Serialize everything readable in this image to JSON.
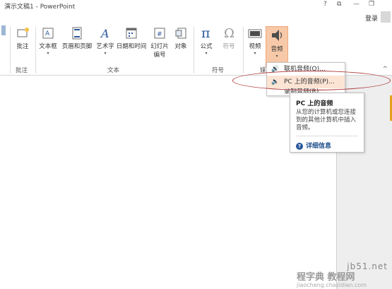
{
  "window": {
    "title": "演示文稿1 - PowerPoint",
    "help": "?",
    "restore_ribbon": "⧉",
    "minimize": "—",
    "maximize": "❐",
    "sign_in": "登录"
  },
  "ribbon": {
    "buttons": {
      "comment": "批注",
      "textbox": "文本框",
      "header_footer": "页眉和页脚",
      "wordart": "艺术字",
      "datetime": "日期和时间",
      "slide_number_l1": "幻灯片",
      "slide_number_l2": "编号",
      "object": "对象",
      "equation": "公式",
      "symbol": "符号",
      "video": "视频",
      "audio": "音频"
    },
    "groups": {
      "comments": "批注",
      "text": "文本",
      "symbols": "符号",
      "media": "媒"
    },
    "collapse": "^"
  },
  "audio_menu": {
    "items": [
      {
        "label": "联机音频(O)..."
      },
      {
        "label": "PC 上的音频(P)..."
      },
      {
        "label": "录制音频(R)..."
      }
    ]
  },
  "tooltip": {
    "title": "PC 上的音频",
    "body": "从您的计算机或您连接到的其他计算机中插入音频。",
    "link": "详细信息"
  },
  "watermark": {
    "line1": "jb51.net",
    "line2": "程字典 教程网",
    "line3": "jiaocheng.chazidian.com"
  },
  "colors": {
    "accent": "#b7472a",
    "audio_active_bg": "#f7c9a9",
    "menu_highlight": "#fce4d4",
    "annotation_ellipse": "#b03a3a"
  }
}
